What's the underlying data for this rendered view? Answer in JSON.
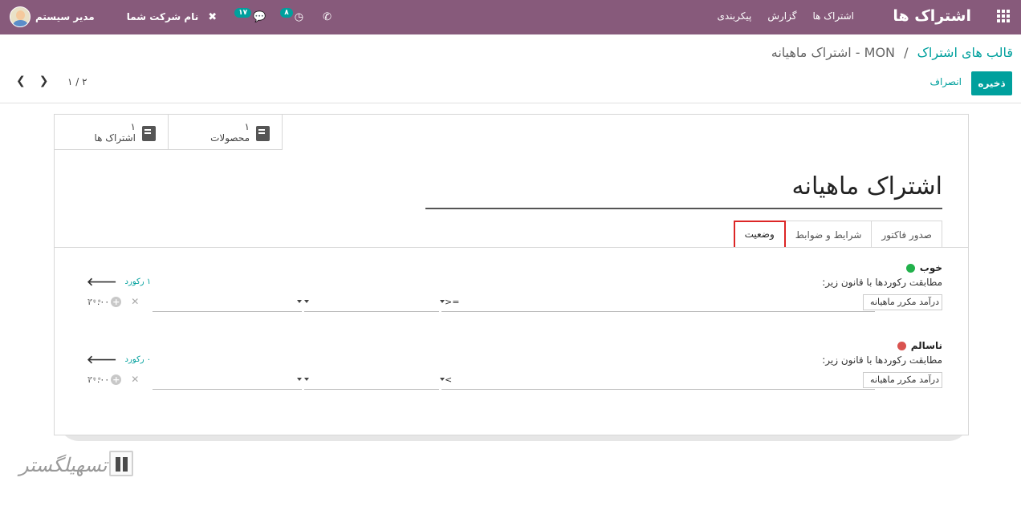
{
  "navbar": {
    "brand": "اشتراک ها",
    "menu": [
      "اشتراک ها",
      "گزارش",
      "پیکربندی"
    ],
    "user_name": "مدیر سیستم",
    "company_name": "نام شرکت شما",
    "activity_badge": "۸",
    "messages_badge": "۱۷",
    "accent_color": "#875a7b"
  },
  "control_panel": {
    "breadcrumb_parent": "قالب های اشتراک",
    "breadcrumb_separator": "/",
    "breadcrumb_current": "MON - اشتراک ماهیانه",
    "save_label": "ذخیره",
    "discard_label": "انصراف",
    "pager": "۱ / ۲"
  },
  "smart_buttons": [
    {
      "count": "۱",
      "label": "محصولات",
      "icon": "book-icon"
    },
    {
      "count": "۱",
      "label": "اشتراک ها",
      "icon": "book-icon"
    }
  ],
  "form": {
    "title": "اشتراک ماهیانه",
    "tabs": [
      "صدور فاکتور",
      "شرایط و ضوابط",
      "وضعیت"
    ],
    "active_tab": "وضعیت"
  },
  "statuses": [
    {
      "label": "خوب",
      "color": "#21b14b",
      "rule_text": "مطابقت رکوردها با قانون زیر:",
      "records": "۱ رکورد",
      "field": "درآمد مکرر ماهیانه",
      "operator": ">=",
      "value": "۲۰.۰۰"
    },
    {
      "label": "ناسالم",
      "color": "#d9534f",
      "rule_text": "مطابقت رکوردها با قانون زیر:",
      "records": "۰ رکورد",
      "field": "درآمد مکرر ماهیانه",
      "operator": "<",
      "value": "۲۰.۰۰"
    }
  ],
  "watermark": {
    "text": "تسهیلگستر"
  }
}
